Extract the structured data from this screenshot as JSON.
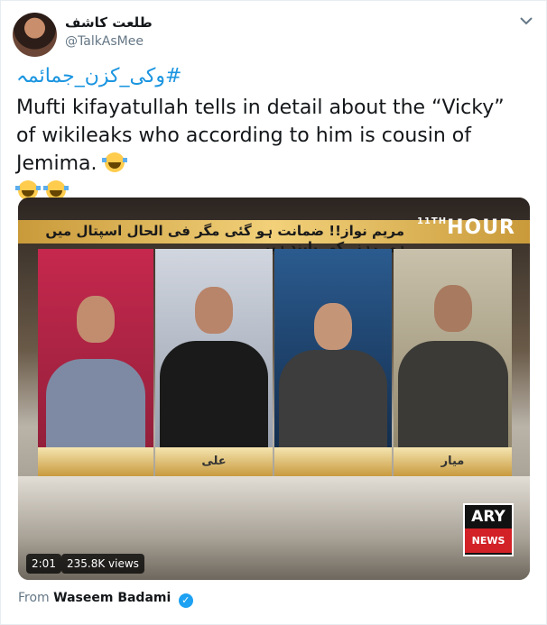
{
  "author": {
    "display_name": "طلعت کاشف",
    "handle": "@TalkAsMee"
  },
  "tweet": {
    "hashtag": "#وکی_کزن_جمائمہ",
    "text": "Mufti kifayatullah tells in detail about the “Vicky” of wikileaks who according to him is cousin of Jemima.",
    "emojis": [
      "rolling-on-floor-laughing",
      "rolling-on-floor-laughing",
      "rolling-on-floor-laughing"
    ]
  },
  "video": {
    "ticker": "مریم نواز!! ضمانت ہو گئی مگر فی الحال اسپتال میں ہی رہنے کی پابند ہیں",
    "show_logo_main": "HOUR",
    "show_logo_prefix": "11TH",
    "nameplates": [
      "",
      "علی",
      "",
      "میار"
    ],
    "channel_logo_top": "ARY",
    "channel_logo_bottom": "NEWS",
    "duration": "2:01",
    "views": "235.8K views"
  },
  "attribution": {
    "from_label": "From",
    "source_name": "Waseem Badami"
  },
  "colors": {
    "link": "#1b95e0",
    "verified": "#1da1f2",
    "secondary_text": "#657786"
  }
}
